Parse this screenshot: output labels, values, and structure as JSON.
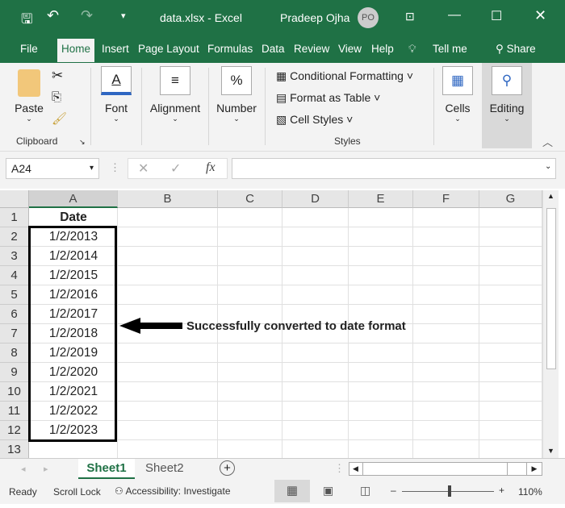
{
  "title": {
    "file": "data.xlsx  -  Excel",
    "user": "Pradeep Ojha",
    "initials": "PO"
  },
  "tabs": [
    "File",
    "Home",
    "Insert",
    "Page Layout",
    "Formulas",
    "Data",
    "Review",
    "View",
    "Help",
    "Tell me",
    "Share"
  ],
  "ribbon": {
    "paste": "Paste",
    "clipboard": "Clipboard",
    "font": "Font",
    "alignment": "Alignment",
    "number": "Number",
    "conditional": "Conditional Formatting",
    "format_table": "Format as Table",
    "cell_styles": "Cell Styles",
    "styles": "Styles",
    "cells": "Cells",
    "editing": "Editing"
  },
  "formula_bar": {
    "name_box": "A24",
    "value": "",
    "fx": "fx"
  },
  "columns": [
    "A",
    "B",
    "C",
    "D",
    "E",
    "F",
    "G"
  ],
  "rows": [
    "1",
    "2",
    "3",
    "4",
    "5",
    "6",
    "7",
    "8",
    "9",
    "10",
    "11",
    "12",
    "13"
  ],
  "cells": [
    "Date",
    "1/2/2013",
    "1/2/2014",
    "1/2/2015",
    "1/2/2016",
    "1/2/2017",
    "1/2/2018",
    "1/2/2019",
    "1/2/2020",
    "1/2/2021",
    "1/2/2022",
    "1/2/2023"
  ],
  "annotation": "Successfully converted to date format",
  "sheets": [
    "Sheet1",
    "Sheet2"
  ],
  "status": {
    "ready": "Ready",
    "scroll_lock": "Scroll Lock",
    "accessibility": "Accessibility: Investigate",
    "zoom": "110%"
  },
  "colors": {
    "green": "#1f7145"
  }
}
